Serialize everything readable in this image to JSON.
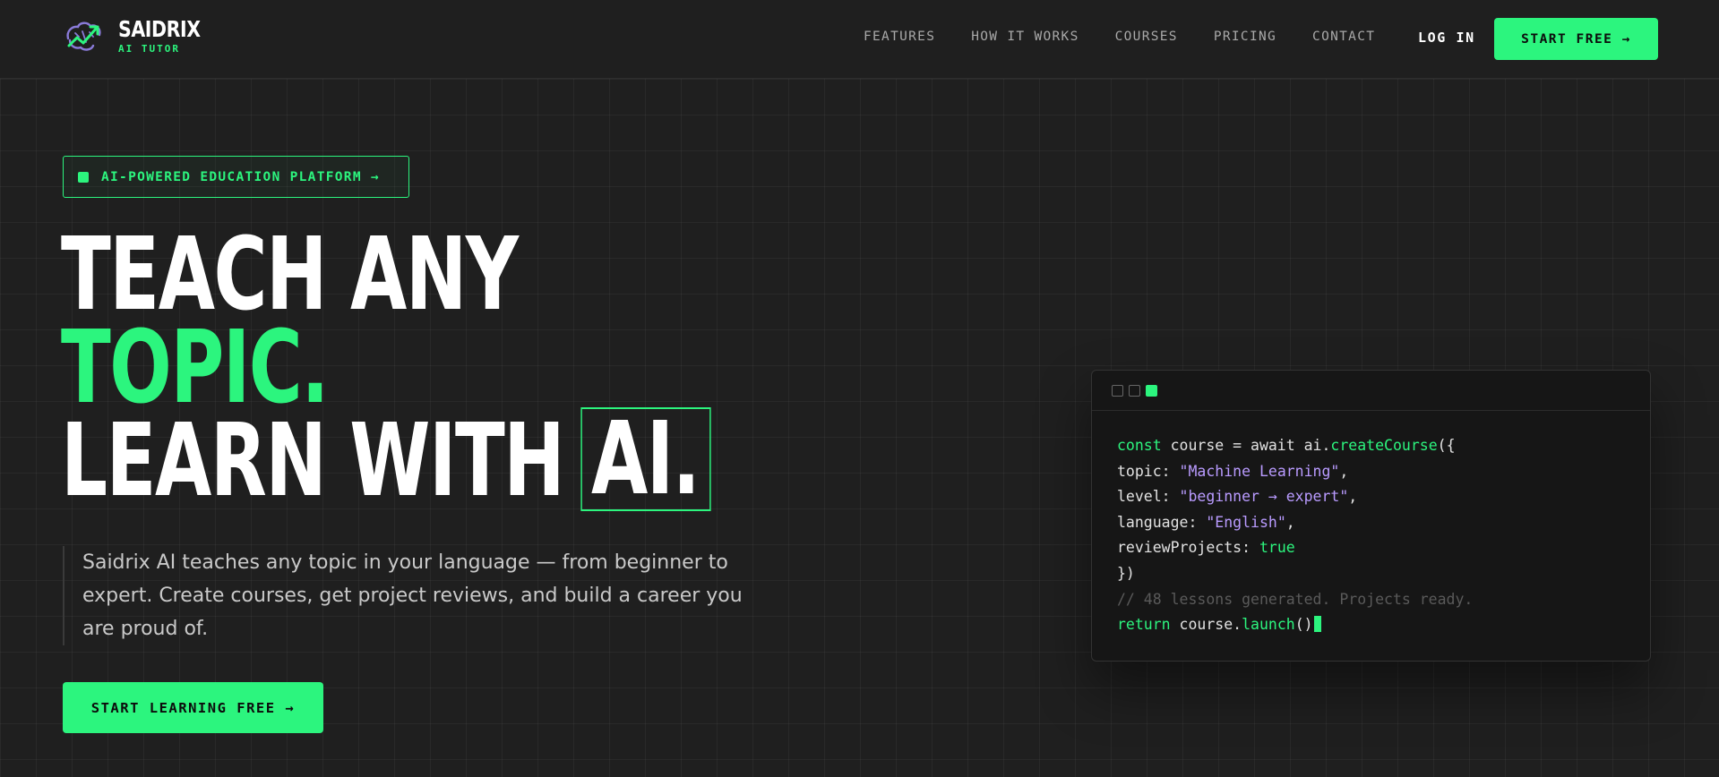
{
  "brand": {
    "name": "SAIDRIX",
    "tagline": "AI TUTOR",
    "accent": "#2cf57e",
    "background": "#1f1f1f"
  },
  "nav": {
    "items": [
      "FEATURES",
      "HOW IT WORKS",
      "COURSES",
      "PRICING",
      "CONTACT"
    ],
    "login_label": "LOG IN",
    "start_label": "START FREE →"
  },
  "hero": {
    "badge": "AI-POWERED EDUCATION PLATFORM →",
    "line1": "TEACH ANY",
    "line2": "TOPIC.",
    "line3": "LEARN WITH",
    "line3_boxed": "AI.",
    "description": "Saidrix AI teaches any topic in your language — from beginner to expert. Create courses, get project reviews, and build a career you are proud of.",
    "cta_label": "START LEARNING FREE →"
  },
  "code": {
    "kw_const": "const",
    "l1_mid": " course = await ai.",
    "l1_fn": "createCourse",
    "l1_end": "({",
    "topic_key": "topic: ",
    "topic_val": "\"Machine Learning\"",
    "level_key": "level: ",
    "level_val": "\"beginner → expert\"",
    "language_key": "language: ",
    "language_val": "\"English\"",
    "review_key": "reviewProjects: ",
    "review_val": "true",
    "close": "})",
    "comment": "// 48 lessons generated. Projects ready.",
    "kw_return": "return",
    "ret_mid": " course.",
    "ret_fn": "launch",
    "ret_end": "()"
  }
}
